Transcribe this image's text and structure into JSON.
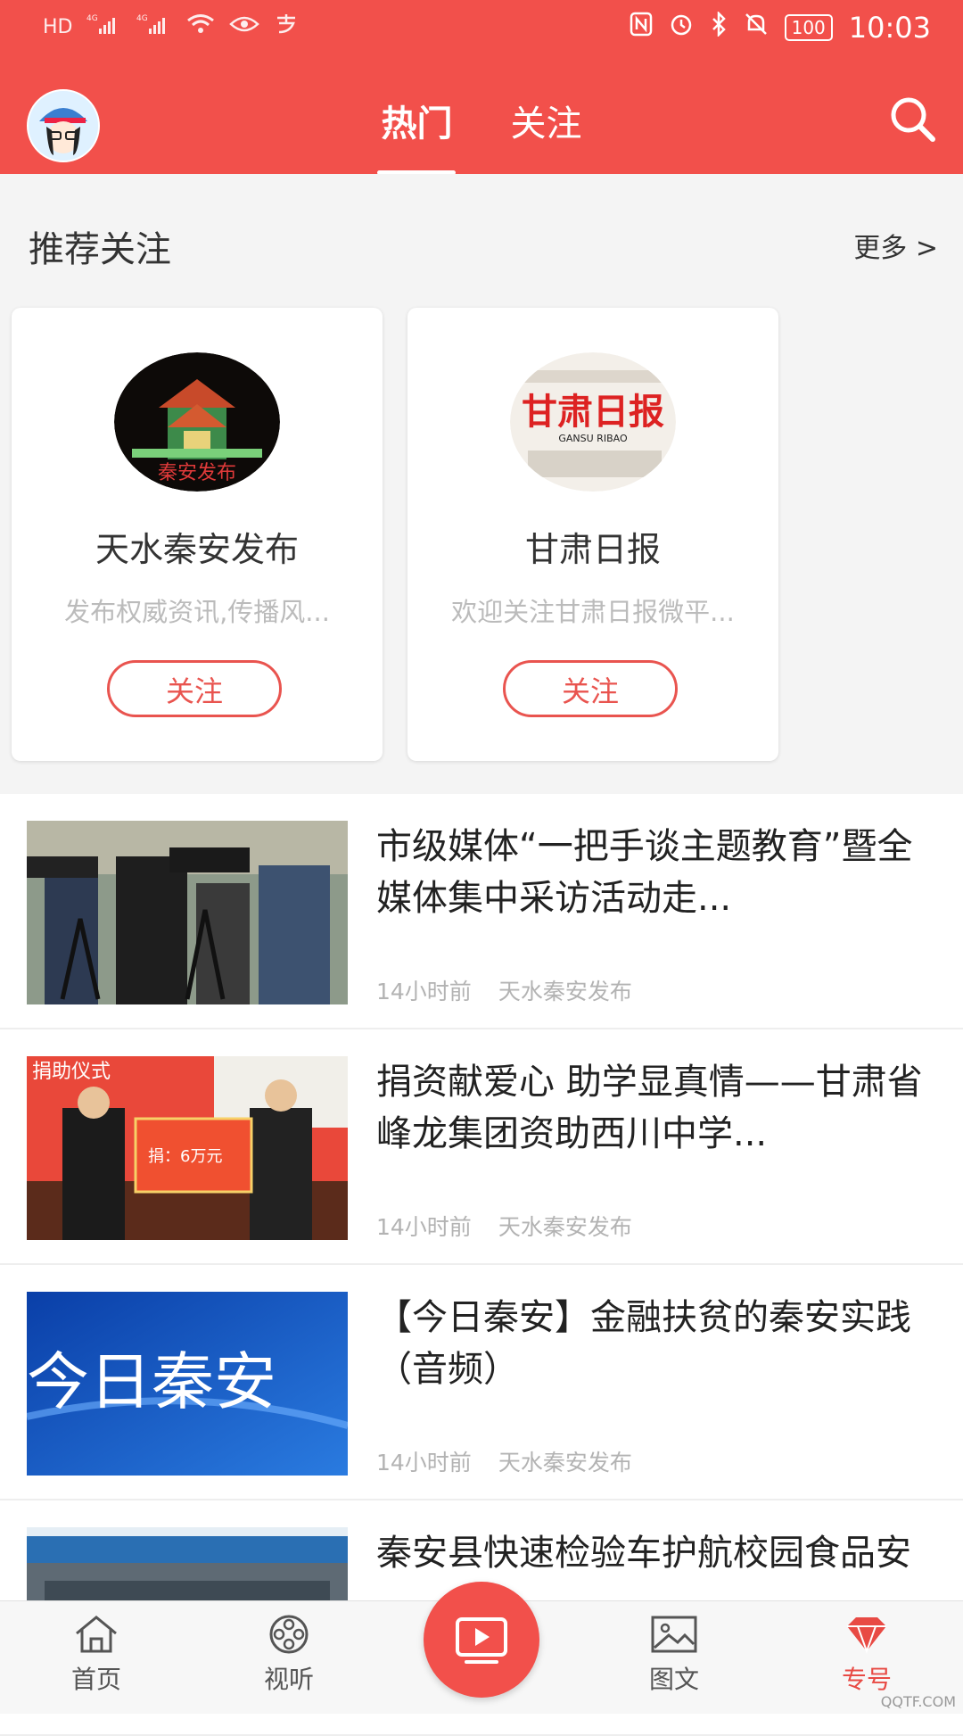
{
  "status_bar": {
    "left_indicators": [
      "HD",
      "4G",
      "4G"
    ],
    "battery": "100",
    "time": "10:03"
  },
  "header": {
    "tabs": [
      {
        "label": "热门",
        "active": true
      },
      {
        "label": "关注",
        "active": false
      }
    ],
    "icons": {
      "search": "search-icon",
      "avatar": "avatar"
    },
    "accent_color": "#f2504b"
  },
  "recommend": {
    "title": "推荐关注",
    "more": "更多 >",
    "cards": [
      {
        "name": "天水秦安发布",
        "desc": "发布权威资讯,传播风...",
        "follow": "关注",
        "logo_text": "秦安发布"
      },
      {
        "name": "甘肃日报",
        "desc": "欢迎关注甘肃日报微平...",
        "follow": "关注",
        "logo_text": "甘肃日报",
        "logo_sub": "GANSU RIBAO"
      }
    ]
  },
  "news": [
    {
      "title": "市级媒体“一把手谈主题教育”暨全媒体集中采访活动走...",
      "time": "14小时前",
      "source": "天水秦安发布"
    },
    {
      "title": "捐资献爱心 助学显真情——甘肃省峰龙集团资助西川中学...",
      "time": "14小时前",
      "source": "天水秦安发布"
    },
    {
      "title": "【今日秦安】金融扶贫的秦安实践（音频）",
      "time": "14小时前",
      "source": "天水秦安发布",
      "thumb_text": "今日秦安"
    },
    {
      "title": "秦安县快速检验车护航校园食品安",
      "time": "",
      "source": ""
    }
  ],
  "thumb_texts": {
    "item2_banner": "捐：6万元",
    "item2_sign": "捐助仪式"
  },
  "bottom_nav": [
    {
      "label": "首页",
      "icon": "home-icon"
    },
    {
      "label": "视听",
      "icon": "film-reel-icon"
    },
    {
      "label": "",
      "icon": "tv-play-icon"
    },
    {
      "label": "图文",
      "icon": "image-icon"
    },
    {
      "label": "专号",
      "icon": "diamond-icon",
      "active": true
    }
  ],
  "watermark": "QQTF.COM"
}
